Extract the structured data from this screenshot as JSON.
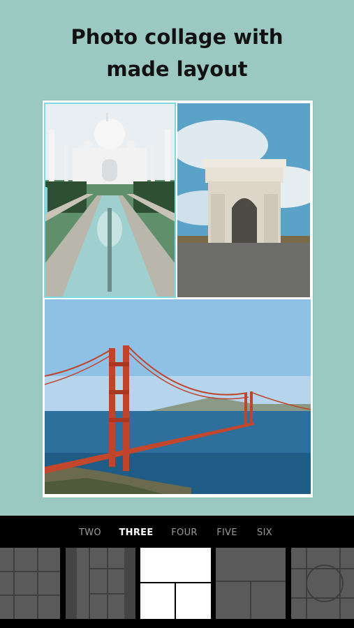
{
  "headline": {
    "line1": "Photo collage with",
    "line2": "made layout"
  },
  "collage": {
    "photos": [
      {
        "name": "taj-mahal-photo",
        "selected": true
      },
      {
        "name": "arc-de-triomphe-photo",
        "selected": false
      },
      {
        "name": "golden-gate-bridge-photo",
        "selected": false
      }
    ]
  },
  "layout_tabs": {
    "items": [
      {
        "label": "TWO"
      },
      {
        "label": "THREE"
      },
      {
        "label": "FOUR"
      },
      {
        "label": "FIVE"
      },
      {
        "label": "SIX"
      }
    ],
    "active": "THREE"
  },
  "colors": {
    "background": "#9cc8c2",
    "selection_accent": "#7fd9e0",
    "bottom_bar": "#000000"
  }
}
